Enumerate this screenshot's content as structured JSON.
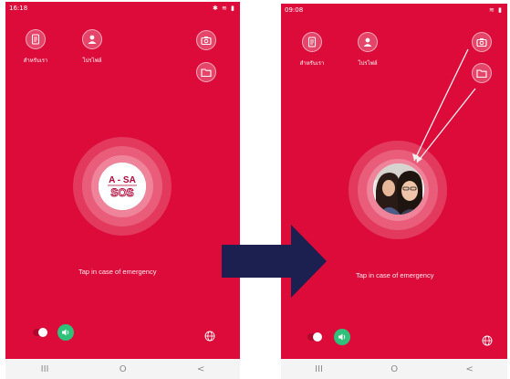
{
  "left_phone": {
    "status_time": "16:18",
    "menu_label": "สำหรับเรา",
    "profile_label": "โปรไฟล์",
    "sos_logo_line1": "A - SA",
    "sos_logo_line2": "SOS",
    "tap_text": "Tap in case of emergency",
    "nav": [
      "III",
      "O",
      "<"
    ]
  },
  "right_phone": {
    "status_time": "09:08",
    "menu_label": "สำหรับเรา",
    "profile_label": "โปรไฟล์",
    "tap_text": "Tap in case of emergency",
    "nav": [
      "III",
      "O",
      "<"
    ]
  },
  "colors": {
    "screen_red": "#dc0b3a",
    "arrow_navy": "#1b2050",
    "sound_green": "#2fc07a",
    "callout_line": "#f0f0f0"
  },
  "icons": [
    "document-icon",
    "profile-icon",
    "camera-icon",
    "folder-icon",
    "sound-icon",
    "globe-icon"
  ]
}
